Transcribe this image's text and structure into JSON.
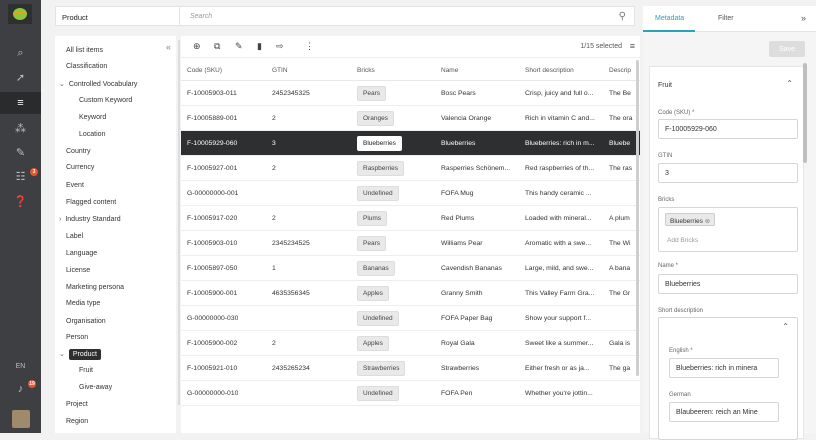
{
  "topbar": {
    "product_label": "Product",
    "search_placeholder": "Search"
  },
  "rail": {
    "lang": "EN",
    "badge_filter": "3",
    "badge_bell": "19"
  },
  "tree": {
    "items": [
      {
        "label": "All list items"
      },
      {
        "label": "Classification"
      },
      {
        "label": "Controlled Vocabulary",
        "arrow": "v"
      },
      {
        "label": "Custom Keyword"
      },
      {
        "label": "Keyword"
      },
      {
        "label": "Location"
      },
      {
        "label": "Country"
      },
      {
        "label": "Currency"
      },
      {
        "label": "Event"
      },
      {
        "label": "Flagged content"
      },
      {
        "label": "Industry Standard",
        "arrow": ">"
      },
      {
        "label": "Label"
      },
      {
        "label": "Language"
      },
      {
        "label": "License"
      },
      {
        "label": "Marketing persona"
      },
      {
        "label": "Media type"
      },
      {
        "label": "Organisation"
      },
      {
        "label": "Person"
      },
      {
        "label": "Product",
        "arrow": "v"
      },
      {
        "label": "Fruit"
      },
      {
        "label": "Give-away"
      },
      {
        "label": "Project"
      },
      {
        "label": "Region"
      }
    ]
  },
  "grid": {
    "selection": "1/15 selected",
    "columns": [
      "Code (SKU)",
      "GTIN",
      "Bricks",
      "Name",
      "Short description",
      "Descrip"
    ],
    "rows": [
      {
        "sku": "F-10005903-011",
        "gtin": "2452345325",
        "brick": "Pears",
        "name": "Bosc Pears",
        "short": "Crisp, juicy and full o...",
        "desc": "The Be"
      },
      {
        "sku": "F-10005889-001",
        "gtin": "2",
        "brick": "Oranges",
        "name": "Valencia Orange",
        "short": "Rich in vitamin C and...",
        "desc": "The ora"
      },
      {
        "sku": "F-10005929-060",
        "gtin": "3",
        "brick": "Blueberries",
        "name": "Blueberries",
        "short": "Blueberries: rich in m...",
        "desc": "Bluebe",
        "selected": true
      },
      {
        "sku": "F-10005927-001",
        "gtin": "2",
        "brick": "Raspberries",
        "name": "Rasperries Schönem...",
        "short": "Red raspberries of th...",
        "desc": "The ras"
      },
      {
        "sku": "G-00000000-001",
        "gtin": "",
        "brick": "Undefined",
        "name": "FOFA Mug",
        "short": "This handy ceramic ...",
        "desc": ""
      },
      {
        "sku": "F-10005917-020",
        "gtin": "2",
        "brick": "Plums",
        "name": "Red Plums",
        "short": "Loaded with mineral...",
        "desc": "A plum"
      },
      {
        "sku": "F-10005903-010",
        "gtin": "2345234525",
        "brick": "Pears",
        "name": "Williams Pear",
        "short": "Aromatic with a swe...",
        "desc": "The Wi"
      },
      {
        "sku": "F-10005897-050",
        "gtin": "1",
        "brick": "Bananas",
        "name": "Cavendish Bananas",
        "short": "Large, mild, and swe...",
        "desc": "A bana"
      },
      {
        "sku": "F-10005900-001",
        "gtin": "4635356345",
        "brick": "Apples",
        "name": "Granny Smith",
        "short": "This Valley Farm Gra...",
        "desc": "The Gr"
      },
      {
        "sku": "G-00000000-030",
        "gtin": "",
        "brick": "Undefined",
        "name": "FOFA Paper Bag",
        "short": "Show your support f...",
        "desc": ""
      },
      {
        "sku": "F-10005900-002",
        "gtin": "2",
        "brick": "Apples",
        "name": "Royal Gala",
        "short": "Sweet like a summer...",
        "desc": "Gala is"
      },
      {
        "sku": "F-10005921-010",
        "gtin": "2435265234",
        "brick": "Strawberries",
        "name": "Strawberries",
        "short": "Either fresh or as ja...",
        "desc": "The ga"
      },
      {
        "sku": "G-00000000-010",
        "gtin": "",
        "brick": "Undefined",
        "name": "FOFA Pen",
        "short": "Whether you're jottin...",
        "desc": ""
      }
    ]
  },
  "panel": {
    "tab_metadata": "Metadata",
    "tab_filter": "Filter",
    "save": "Save",
    "card_title": "Fruit",
    "sku_label": "Code (SKU) *",
    "sku_value": "F-10005929-060",
    "gtin_label": "GTIN",
    "gtin_value": "3",
    "bricks_label": "Bricks",
    "bricks_chip": "Blueberries",
    "bricks_add": "Add Bricks",
    "name_label": "Name *",
    "name_value": "Blueberries",
    "short_label": "Short description",
    "english_label": "English *",
    "english_value": "Blueberries: rich in minera",
    "german_label": "German",
    "german_value": "Blaubeeren: reich an Mine"
  }
}
